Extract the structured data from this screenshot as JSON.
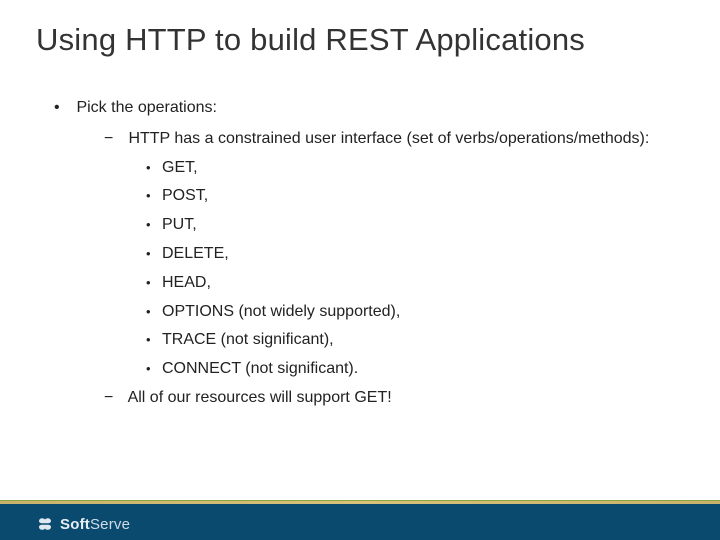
{
  "title": "Using HTTP to build REST Applications",
  "bullets": {
    "l1_0": "Pick the operations:",
    "l2_0": "HTTP has a constrained user interface (set of verbs/operations/methods):",
    "methods": {
      "m0": "GET,",
      "m1": "POST,",
      "m2": "PUT,",
      "m3": "DELETE,",
      "m4": "HEAD,",
      "m5": "OPTIONS (not widely supported),",
      "m6": "TRACE (not significant),",
      "m7": "CONNECT (not significant)."
    },
    "l2_1": "All of our resources will support GET!"
  },
  "footer": {
    "brand_bold": "Soft",
    "brand_light": "Serve"
  }
}
